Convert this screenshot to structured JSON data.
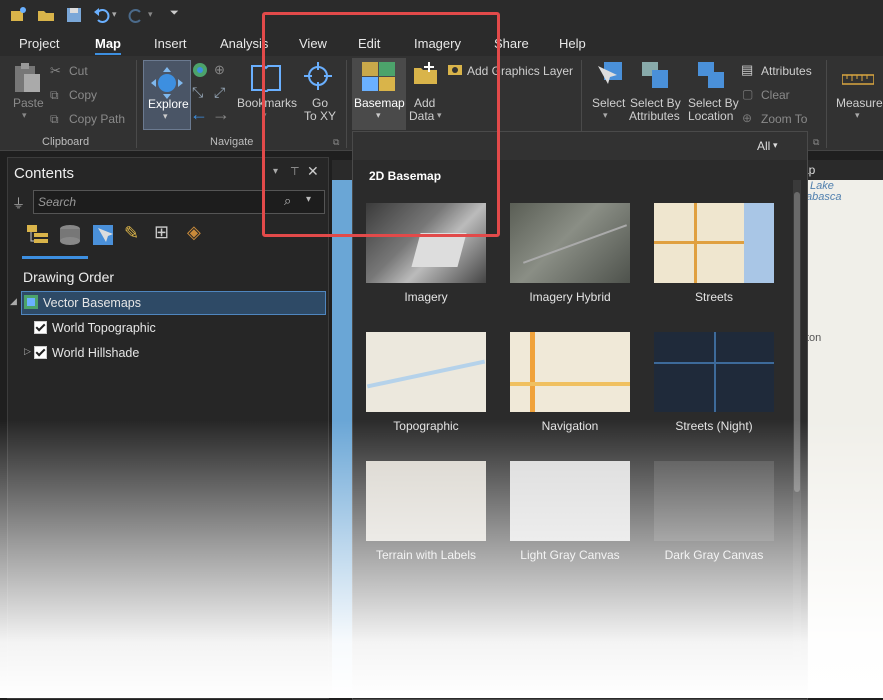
{
  "menu": {
    "tabs": [
      {
        "label": "Project"
      },
      {
        "label": "Map",
        "active": true
      },
      {
        "label": "Insert"
      },
      {
        "label": "Analysis"
      },
      {
        "label": "View"
      },
      {
        "label": "Edit"
      },
      {
        "label": "Imagery"
      },
      {
        "label": "Share"
      },
      {
        "label": "Help"
      }
    ]
  },
  "ribbon": {
    "clipboard": {
      "paste": "Paste",
      "cut": "Cut",
      "copy": "Copy",
      "copy_path": "Copy Path",
      "group": "Clipboard"
    },
    "navigate": {
      "explore": "Explore",
      "bookmarks": "Bookmarks",
      "go_to_xy_line1": "Go",
      "go_to_xy_line2": "To XY",
      "group": "Navigate"
    },
    "layer": {
      "basemap": "Basemap",
      "add_data_line1": "Add",
      "add_data_line2": "Data",
      "add_graphics_layer": "Add Graphics Layer"
    },
    "selection": {
      "select": "Select",
      "select_by_attr_line1": "Select By",
      "select_by_attr_line2": "Attributes",
      "select_by_loc_line1": "Select By",
      "select_by_loc_line2": "Location",
      "attributes": "Attributes",
      "clear": "Clear",
      "zoom_to": "Zoom To"
    },
    "inquiry": {
      "measure": "Measure"
    }
  },
  "contents": {
    "title": "Contents",
    "search_placeholder": "Search",
    "drawing_order": "Drawing Order",
    "layers": [
      {
        "label": "Vector Basemaps",
        "selected": true
      },
      {
        "label": "World Topographic",
        "checked": true
      },
      {
        "label": "World Hillshade",
        "checked": true
      }
    ]
  },
  "gallery": {
    "filter": "All",
    "section": "2D Basemap",
    "items": [
      {
        "label": "Imagery"
      },
      {
        "label": "Imagery Hybrid"
      },
      {
        "label": "Streets"
      },
      {
        "label": "Topographic"
      },
      {
        "label": "Navigation"
      },
      {
        "label": "Streets (Night)"
      },
      {
        "label": "Terrain with Labels"
      },
      {
        "label": "Light Gray Canvas"
      },
      {
        "label": "Dark Gray Canvas"
      }
    ]
  },
  "map": {
    "tab_fragment": "ap",
    "label_lake": "Lake",
    "label_athabasca": "abasca",
    "label_ton": "ton"
  },
  "colors": {
    "accent": "#3d8fe0",
    "highlight": "#e24a4a"
  }
}
